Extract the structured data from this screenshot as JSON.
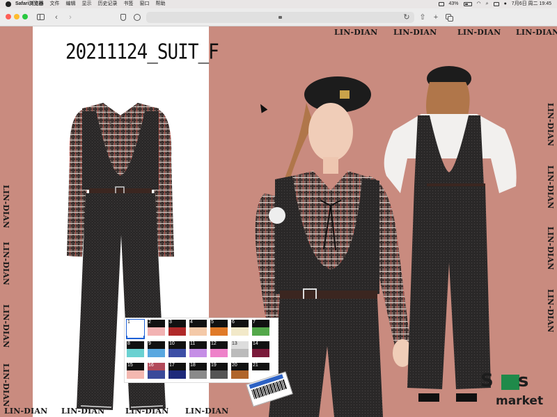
{
  "menubar": {
    "app": "Safari浏览器",
    "items": [
      "文件",
      "编辑",
      "显示",
      "历史记录",
      "书签",
      "窗口",
      "帮助"
    ],
    "battery": "43%",
    "datetime": "7月6日 周二 19:45"
  },
  "toolbar": {
    "url": ""
  },
  "content": {
    "outfit_title": "20211124_SUIT_F",
    "watermark": "LIN-DIAN",
    "logo_line1": "Sims",
    "logo_line2": "market"
  },
  "palette": {
    "selected": "1",
    "swatches": [
      {
        "n": "1",
        "top": "#ffffff",
        "bottom": "#ffffff"
      },
      {
        "n": "2",
        "top": "#111111",
        "bottom": "#f2b2b2"
      },
      {
        "n": "3",
        "top": "#111111",
        "bottom": "#b02a2a"
      },
      {
        "n": "4",
        "top": "#111111",
        "bottom": "#f4c9a8"
      },
      {
        "n": "5",
        "top": "#111111",
        "bottom": "#e07a28"
      },
      {
        "n": "6",
        "top": "#111111",
        "bottom": "#f2e9c9"
      },
      {
        "n": "7",
        "top": "#111111",
        "bottom": "#53a84a"
      },
      {
        "n": "8",
        "top": "#111111",
        "bottom": "#6ad1d1"
      },
      {
        "n": "9",
        "top": "#111111",
        "bottom": "#5aa8e0"
      },
      {
        "n": "10",
        "top": "#111111",
        "bottom": "#3d4fa6"
      },
      {
        "n": "11",
        "top": "#111111",
        "bottom": "#c58ee6"
      },
      {
        "n": "12",
        "top": "#111111",
        "bottom": "#ee82c9"
      },
      {
        "n": "13",
        "top": "#dddddd",
        "bottom": "#bbbbbb"
      },
      {
        "n": "14",
        "top": "#111111",
        "bottom": "#7a1a3a"
      },
      {
        "n": "15",
        "top": "#111111",
        "bottom": "#f4b8b0"
      },
      {
        "n": "16",
        "top": "#b24a5a",
        "bottom": "#3b4a9a"
      },
      {
        "n": "17",
        "top": "#111111",
        "bottom": "#1e2a7a"
      },
      {
        "n": "18",
        "top": "#111111",
        "bottom": "#8a8a8a"
      },
      {
        "n": "19",
        "top": "#111111",
        "bottom": "#555555"
      },
      {
        "n": "20",
        "top": "#111111",
        "bottom": "#b0652a"
      },
      {
        "n": "21",
        "top": "#111111",
        "bottom": "#ffffff"
      }
    ]
  },
  "colors": {
    "background": "#c98b7f",
    "panel": "#ffffff",
    "select_outline": "#1b5fd6"
  }
}
